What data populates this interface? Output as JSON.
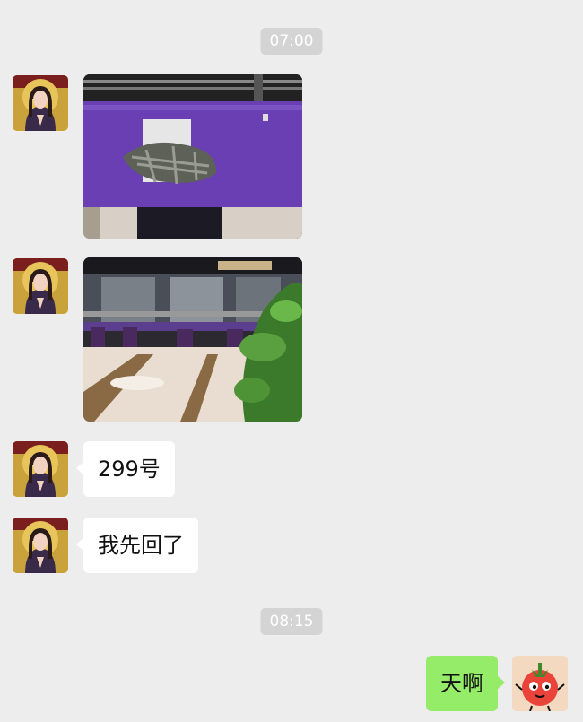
{
  "timestamps": [
    "07:00",
    "08:15"
  ],
  "messages": [
    {
      "sender": "contact",
      "type": "image",
      "image_name": "purple-counter-with-clothes-photo"
    },
    {
      "sender": "contact",
      "type": "image",
      "image_name": "lobby-with-chairs-and-plant-photo"
    },
    {
      "sender": "contact",
      "type": "text",
      "text": "299号"
    },
    {
      "sender": "contact",
      "type": "text",
      "text": "我先回了"
    },
    {
      "sender": "self",
      "type": "text",
      "text": "天啊"
    }
  ],
  "contact": {
    "avatar_icon": "contact-avatar-icon"
  },
  "self": {
    "avatar_icon": "tomato-cartoon-avatar-icon"
  },
  "colors": {
    "background": "#ededed",
    "self_bubble": "#95ec69",
    "contact_bubble": "#ffffff",
    "timestamp_bg": "#d4d4d4"
  }
}
